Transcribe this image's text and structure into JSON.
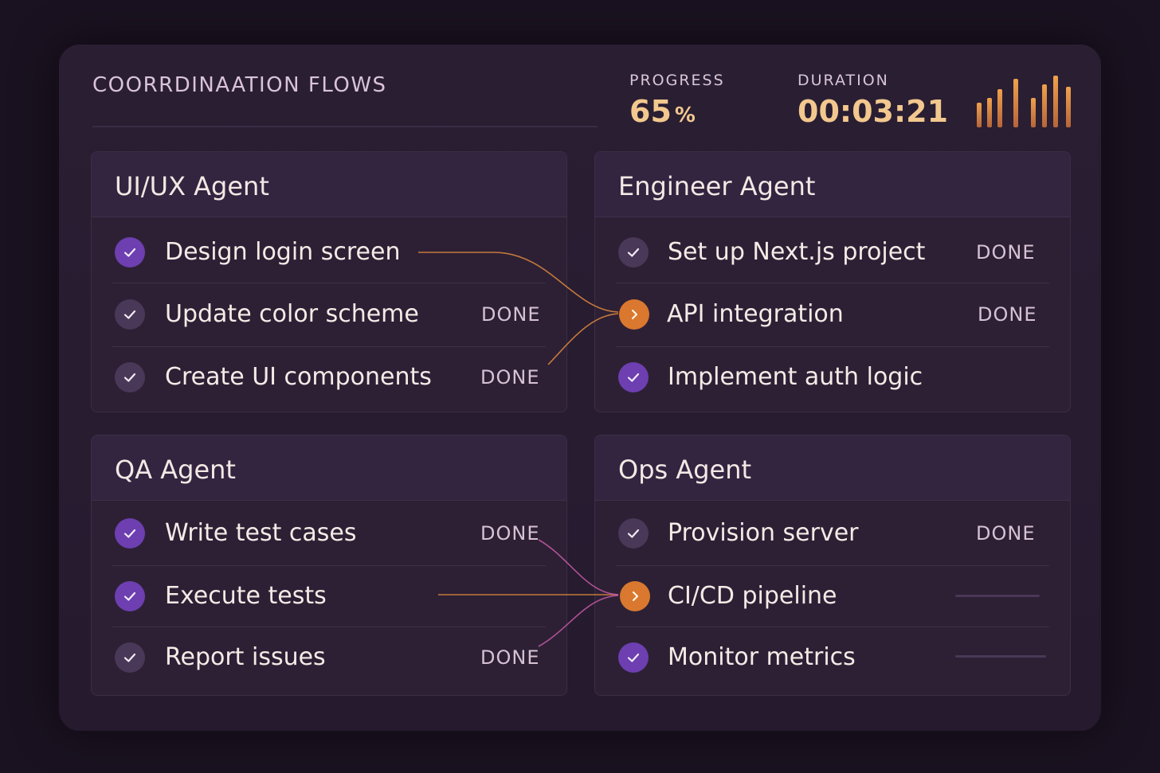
{
  "header": {
    "title": "COORRDINAATION FLOWS",
    "progress_label": "PROGRESS",
    "progress_value": "65",
    "progress_unit": "%",
    "progress_fraction": 0.65,
    "duration_label": "DURATION",
    "duration_value": "00:03:21"
  },
  "activity_bars": {
    "heights_relative": [
      0.45,
      0.55,
      0.7,
      0.9,
      0.55,
      0.8,
      0.95,
      0.75
    ],
    "color": "#f0a14c"
  },
  "colors": {
    "background": "#1a1220",
    "accent_purple": "#6d3fb0",
    "accent_orange": "#d9782e",
    "link_orange": "#e08a3c",
    "link_pink": "#c85aa8"
  },
  "agents": [
    {
      "name": "UI/UX Agent",
      "tasks": [
        {
          "label": "Design login screen",
          "status": "",
          "check": "purple"
        },
        {
          "label": "Update color scheme",
          "status": "DONE",
          "check": "muted"
        },
        {
          "label": "Create UI components",
          "status": "DONE",
          "check": "muted"
        }
      ]
    },
    {
      "name": "Engineer Agent",
      "tasks": [
        {
          "label": "Set up Next.js project",
          "status": "DONE",
          "check": "muted"
        },
        {
          "label": "API integration",
          "status": "DONE",
          "check": "orange"
        },
        {
          "label": "Implement auth logic",
          "status": "",
          "check": "purple"
        }
      ]
    },
    {
      "name": "QA Agent",
      "tasks": [
        {
          "label": "Write test cases",
          "status": "DONE",
          "check": "purple"
        },
        {
          "label": "Execute tests",
          "status": "",
          "check": "purple"
        },
        {
          "label": "Report issues",
          "status": "DONE",
          "check": "muted"
        }
      ]
    },
    {
      "name": "Ops Agent",
      "tasks": [
        {
          "label": "Provision server",
          "status": "DONE",
          "check": "muted"
        },
        {
          "label": "CI/CD pipeline",
          "status": "",
          "check": "orange"
        },
        {
          "label": "Monitor metrics",
          "status": "",
          "check": "purple"
        }
      ]
    }
  ]
}
